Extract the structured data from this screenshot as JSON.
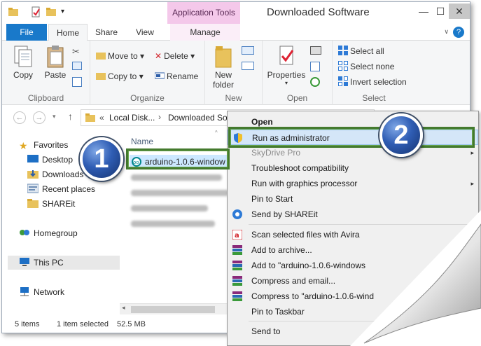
{
  "window": {
    "title": "Downloaded Software",
    "contextual_tab_group": "Application Tools",
    "controls": {
      "minimize": "—",
      "maximize": "☐",
      "close": "✕"
    }
  },
  "ribbon_tabs": [
    "File",
    "Home",
    "Share",
    "View",
    "Manage"
  ],
  "ribbon": {
    "clipboard": {
      "copy": "Copy",
      "paste": "Paste",
      "label": "Clipboard"
    },
    "organize": {
      "move_to": "Move to",
      "copy_to": "Copy to",
      "delete": "Delete",
      "rename": "Rename",
      "label": "Organize"
    },
    "new": {
      "new_folder_line1": "New",
      "new_folder_line2": "folder",
      "label": "New"
    },
    "open": {
      "properties": "Properties",
      "label": "Open"
    },
    "select": {
      "select_all": "Select all",
      "select_none": "Select none",
      "invert_selection": "Invert selection",
      "label": "Select"
    }
  },
  "address": {
    "crumb_prefix": "«",
    "crumbs": [
      "Local Disk...",
      "Downloaded Sof"
    ],
    "separator": "›"
  },
  "nav_pane": {
    "favorites": "Favorites",
    "items": [
      "Desktop",
      "Downloads",
      "Recent places",
      "SHAREit"
    ],
    "homegroup": "Homegroup",
    "this_pc": "This PC",
    "network": "Network"
  },
  "file_list": {
    "column_name": "Name",
    "selected_file": "arduino-1.0.6-window"
  },
  "status": {
    "items": "5 items",
    "selected": "1 item selected",
    "size": "52.5 MB"
  },
  "context_menu": {
    "items": [
      "Open",
      "Run as administrator",
      "SkyDrive Pro",
      "Troubleshoot compatibility",
      "Run with graphics processor",
      "Pin to Start",
      "Send by SHAREit",
      "Scan selected files with Avira",
      "Add to archive...",
      "Add to \"arduino-1.0.6-windows",
      "Compress and email...",
      "Compress to \"arduino-1.0.6-wind",
      "Pin to Taskbar",
      "Send to"
    ]
  },
  "badges": {
    "step1": "1",
    "step2": "2"
  },
  "colors": {
    "accent": "#1979ca",
    "highlight_green": "#447a2e",
    "badge_blue": "#2f5db4",
    "app_tools_pink": "#f4c8ea"
  }
}
